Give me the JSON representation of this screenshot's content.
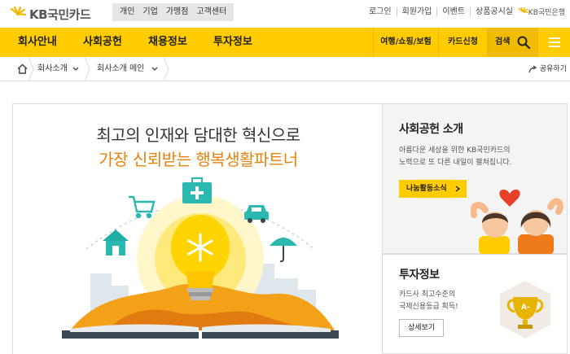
{
  "header": {
    "logo_text": "KB국민카드",
    "segments": [
      "개인",
      "기업",
      "가맹점",
      "고객센터"
    ],
    "util_links": [
      "로그인",
      "회원가입",
      "이벤트",
      "상품공시실"
    ],
    "bank_label": "KB국민은행"
  },
  "gnb": {
    "items": [
      "회사안내",
      "사회공헌",
      "채용정보",
      "투자정보"
    ],
    "right_items": [
      "여행/쇼핑/보험",
      "카드신청"
    ],
    "search_label": "검색"
  },
  "breadcrumb": {
    "items": [
      "회사소개",
      "회사소개 메인"
    ],
    "share_label": "공유하기"
  },
  "hero": {
    "line1": "최고의 인재와 담대한 혁신으로",
    "line2": "가장 신뢰받는 행복생활파트너"
  },
  "social": {
    "title": "사회공헌 소개",
    "desc1": "아름다운 세상을 위한 KB국민카드의",
    "desc2": "노력으로 또 다른 내일이 펼쳐집니다.",
    "button": "나눔활동소식"
  },
  "invest": {
    "title": "투자정보",
    "desc1": "카드사 최고수준의",
    "desc2": "국제신용등급 획득!",
    "button": "상세보기",
    "badge": "A-"
  },
  "colors": {
    "brand_yellow": "#ffcc00",
    "accent_orange": "#e8820c",
    "teal": "#2bb8b0"
  }
}
